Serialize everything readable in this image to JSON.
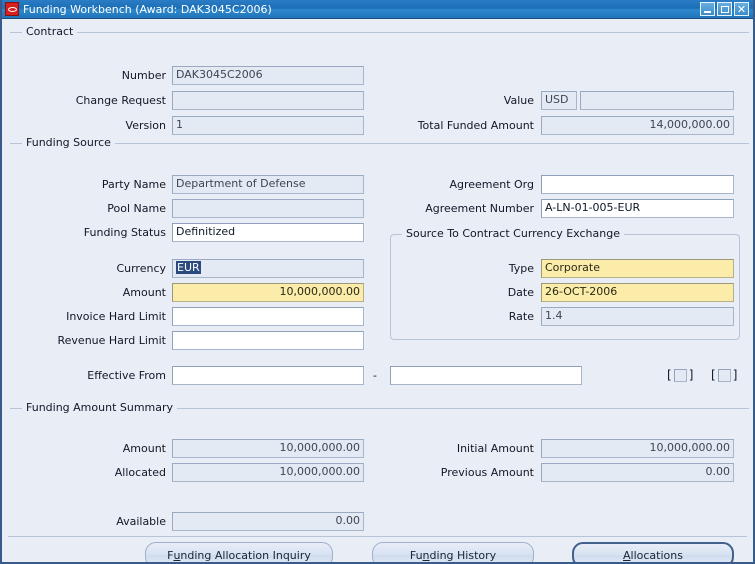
{
  "window": {
    "title": "Funding Workbench (Award: DAK3045C2006)",
    "logo_icon": "oracle-logo-icon",
    "buttons": {
      "minimize": "minimize-icon",
      "maximize": "maximize-icon",
      "close": "close-icon"
    }
  },
  "contract": {
    "legend": "Contract",
    "number_label": "Number",
    "number_value": "DAK3045C2006",
    "change_request_label": "Change Request",
    "change_request_value": "",
    "version_label": "Version",
    "version_value": "1",
    "value_label": "Value",
    "value_currency": "USD",
    "value_amount": "",
    "total_funded_label": "Total Funded Amount",
    "total_funded_value": "14,000,000.00"
  },
  "funding_source": {
    "legend": "Funding Source",
    "party_name_label": "Party Name",
    "party_name_value": "Department of Defense",
    "pool_name_label": "Pool Name",
    "pool_name_value": "",
    "funding_status_label": "Funding Status",
    "funding_status_value": "Definitized",
    "currency_label": "Currency",
    "currency_value": "EUR",
    "amount_label": "Amount",
    "amount_value": "10,000,000.00",
    "invoice_hard_limit_label": "Invoice Hard Limit",
    "invoice_hard_limit_value": "",
    "revenue_hard_limit_label": "Revenue Hard Limit",
    "revenue_hard_limit_value": "",
    "agreement_org_label": "Agreement Org",
    "agreement_org_value": "",
    "agreement_number_label": "Agreement Number",
    "agreement_number_value": "A-LN-01-005-EUR",
    "exchange": {
      "legend": "Source To Contract Currency Exchange",
      "type_label": "Type",
      "type_value": "Corporate",
      "date_label": "Date",
      "date_value": "26-OCT-2006",
      "rate_label": "Rate",
      "rate_value": "1.4"
    },
    "effective_from_label": "Effective From",
    "effective_from_value": "",
    "effective_to_value": "",
    "range_separator": "-",
    "bracket_open": "[",
    "bracket_close": "]",
    "checkbox_one_checked": "false",
    "checkbox_two_checked": "false"
  },
  "funding_amount_summary": {
    "legend": "Funding Amount Summary",
    "amount_label": "Amount",
    "amount_value": "10,000,000.00",
    "allocated_label": "Allocated",
    "allocated_value": "10,000,000.00",
    "initial_amount_label": "Initial Amount",
    "initial_amount_value": "10,000,000.00",
    "previous_amount_label": "Previous Amount",
    "previous_amount_value": "0.00",
    "available_label": "Available",
    "available_value": "0.00"
  },
  "actions": {
    "funding_allocation_inquiry": "Funding Allocation Inquiry",
    "funding_allocation_inquiry_pre": "F",
    "funding_allocation_inquiry_mnemonic": "u",
    "funding_allocation_inquiry_post": "nding Allocation Inquiry",
    "funding_history_pre": "Fu",
    "funding_history_mnemonic": "n",
    "funding_history_post": "ding History",
    "allocations_pre": "",
    "allocations_mnemonic": "A",
    "allocations_post": "llocations"
  },
  "colors": {
    "titlebar": "#1b6fb8",
    "canvas": "#e9edf5",
    "readonly_field": "#e4eaf4",
    "required_field": "#fbeca9",
    "editable_field": "#ffffff",
    "selection": "#2b4a7d",
    "frame": "#3a5a8c"
  }
}
